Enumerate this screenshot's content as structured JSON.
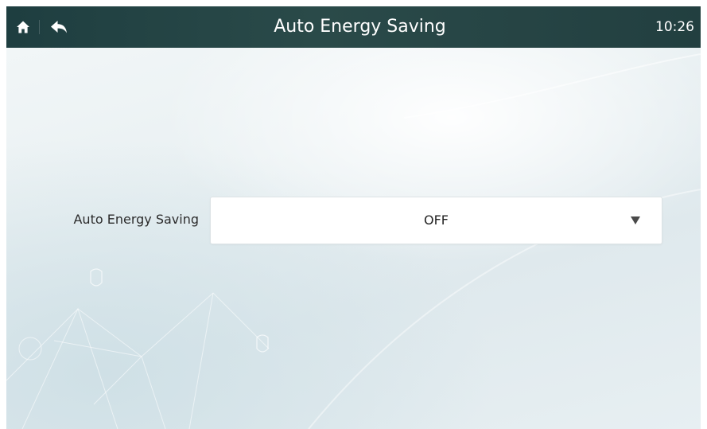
{
  "header": {
    "title": "Auto Energy Saving",
    "time": "10:26",
    "home_icon": "home-icon",
    "back_icon": "back-arrow-icon"
  },
  "setting": {
    "label": "Auto Energy Saving",
    "selected_value": "OFF",
    "arrow_icon": "caret-down-icon"
  },
  "colors": {
    "header_background": "#1e3e40",
    "page_background": "#e6eef1",
    "text": "#2b2b2b"
  }
}
